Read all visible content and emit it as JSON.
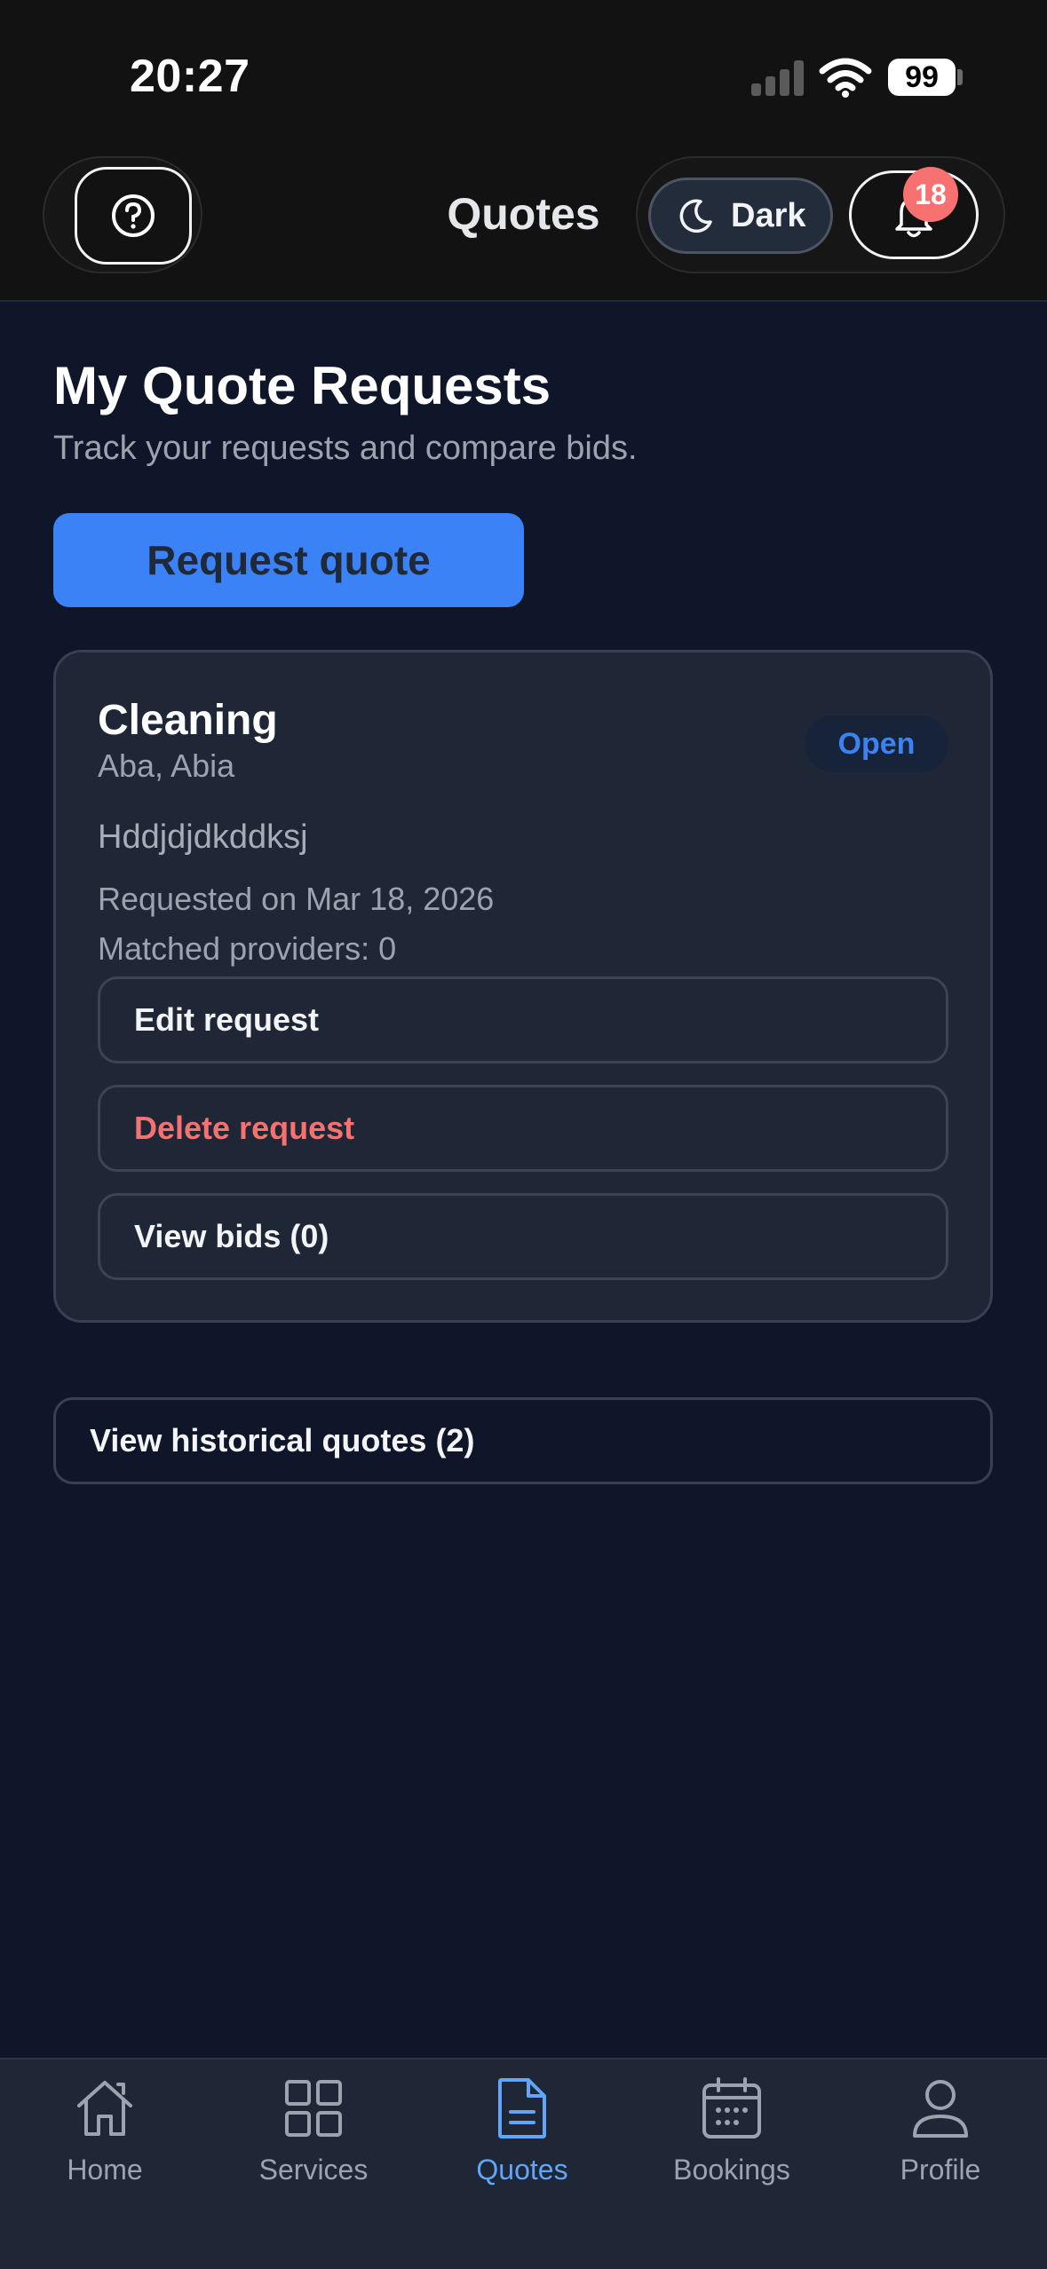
{
  "status_bar": {
    "time": "20:27",
    "battery": "99"
  },
  "header": {
    "title": "Quotes",
    "theme_label": "Dark",
    "notification_count": "18",
    "icons": {
      "help": "help-circle-icon",
      "theme": "moon-icon",
      "notifications": "bell-icon"
    }
  },
  "main": {
    "heading": "My Quote Requests",
    "subtitle": "Track your requests and compare bids.",
    "request_button": "Request quote",
    "request_card": {
      "title": "Cleaning",
      "location": "Aba, Abia",
      "status": "Open",
      "description": "Hddjdjdkddksj",
      "requested_on": "Requested on Mar 18, 2026",
      "matched": "Matched providers: 0",
      "edit_label": "Edit request",
      "delete_label": "Delete request",
      "view_bids_label": "View bids (0)"
    },
    "history_button": "View historical quotes (2)"
  },
  "bottom_nav": {
    "items": [
      {
        "label": "Home",
        "icon": "home-icon"
      },
      {
        "label": "Services",
        "icon": "grid-icon"
      },
      {
        "label": "Quotes",
        "icon": "document-icon",
        "active": true
      },
      {
        "label": "Bookings",
        "icon": "calendar-icon"
      },
      {
        "label": "Profile",
        "icon": "user-icon"
      }
    ]
  },
  "colors": {
    "background": "#0f1629",
    "card": "#1f2737",
    "accent": "#3b82f6",
    "danger": "#f87171",
    "active_nav": "#60a5fa"
  }
}
